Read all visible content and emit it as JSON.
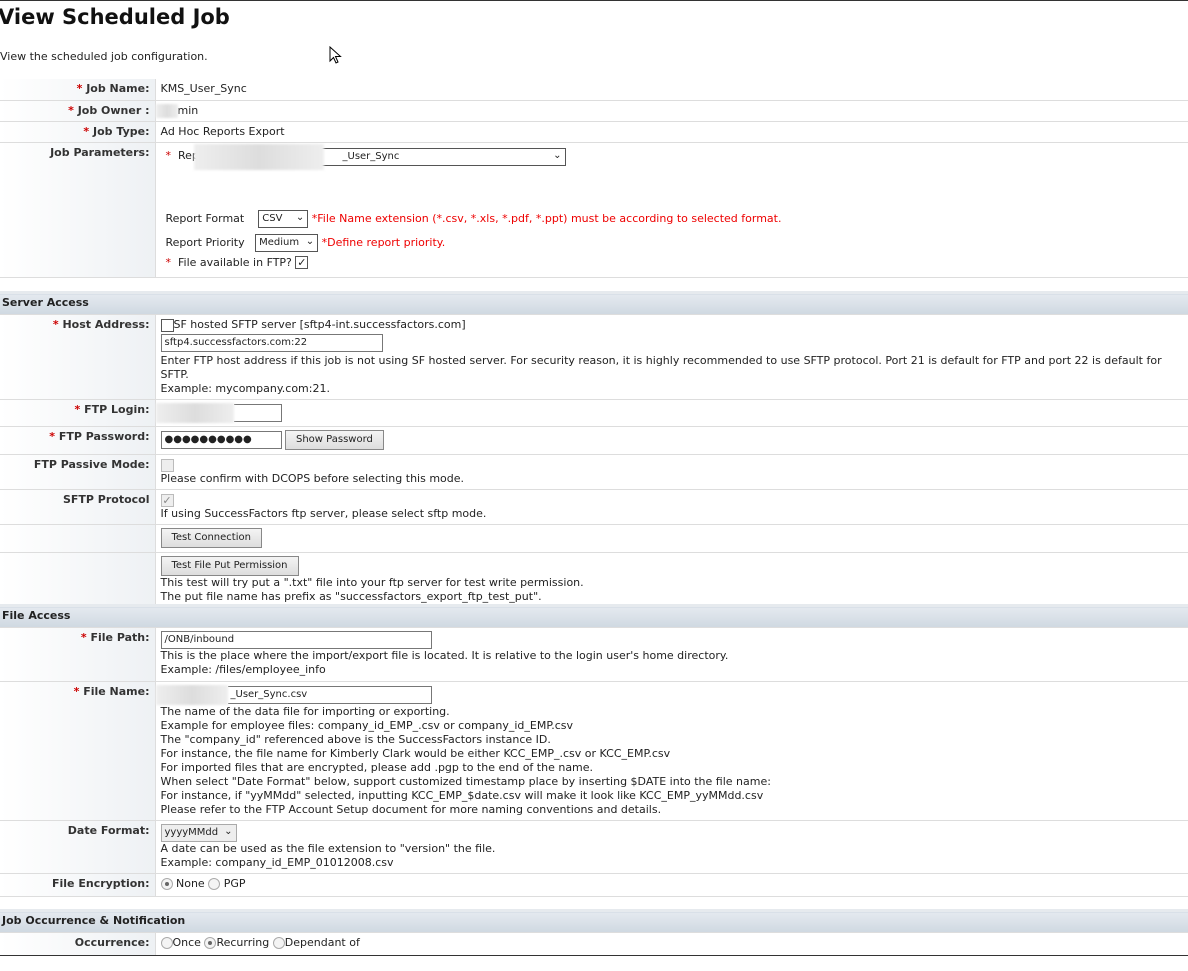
{
  "page": {
    "title": "View Scheduled Job",
    "subtitle": "View the scheduled job configuration."
  },
  "job": {
    "name_label": "Job Name:",
    "name": "KMS_User_Sync",
    "owner_label": "Job Owner :",
    "owner": "min",
    "type_label": "Job Type:",
    "type": "Ad Hoc Reports Export",
    "params_label": "Job Parameters:",
    "report_label": "Repo",
    "report_value": "_User_Sync",
    "format_label": "Report Format",
    "format_value": "CSV",
    "format_note": "*File Name extension (*.csv, *.xls, *.pdf, *.ppt) must be according to selected format.",
    "priority_label": "Report Priority",
    "priority_value": "Medium",
    "priority_note": "*Define report priority.",
    "ftp_label": "File available in FTP?",
    "ftp_checked": true
  },
  "server": {
    "header": "Server Access",
    "host_label": "Host Address:",
    "sf_hosted_label": "SF hosted SFTP server [sftp4-int.successfactors.com]",
    "sf_hosted_checked": false,
    "host_value": "sftp4.successfactors.com:22",
    "host_help": "Enter FTP host address if this job is not using SF hosted server. For security reason, it is highly recommended to use SFTP protocol. Port 21 is default for FTP and port 22 is default for SFTP.",
    "host_example": "Example: mycompany.com:21.",
    "login_label": "FTP Login:",
    "password_label": "FTP Password:",
    "password_value": "●●●●●●●●●●",
    "show_password": "Show Password",
    "passive_label": "FTP Passive Mode:",
    "passive_help": "Please confirm with DCOPS before selecting this mode.",
    "passive_checked": false,
    "sftp_label": "SFTP Protocol",
    "sftp_help": "If using SuccessFactors ftp server, please select sftp mode.",
    "sftp_checked": true,
    "test_connection": "Test Connection",
    "test_put": "Test File Put Permission",
    "test_put_help1": "This test will try put a \".txt\" file into your ftp server for test write permission.",
    "test_put_help2": "The put file name has prefix as \"successfactors_export_ftp_test_put\"."
  },
  "file": {
    "header": "File Access",
    "path_label": "File Path:",
    "path_value": "/ONB/inbound",
    "path_help": "This is the place where the import/export file is located. It is relative to the login user's home directory.",
    "path_example": "Example: /files/employee_info",
    "name_label": "File Name:",
    "name_value": "_User_Sync.csv",
    "name_help": [
      "The name of the data file for importing or exporting.",
      "Example for employee files: company_id_EMP_.csv or company_id_EMP.csv",
      "The \"company_id\" referenced above is the SuccessFactors instance ID.",
      "For instance, the file name for Kimberly Clark would be either KCC_EMP_.csv or KCC_EMP.csv",
      "For imported files that are encrypted, please add .pgp to the end of the name.",
      "When select \"Date Format\" below, support customized timestamp place by inserting $DATE into the file name:",
      "For instance, if \"yyMMdd\" selected, inputting KCC_EMP_$date.csv will make it look like KCC_EMP_yyMMdd.csv",
      "Please refer to the FTP Account Setup document for more naming conventions and details."
    ],
    "date_label": "Date Format:",
    "date_value": "yyyyMMdd",
    "date_help": "A date can be used as the file extension to \"version\" the file.",
    "date_example": "Example: company_id_EMP_01012008.csv",
    "enc_label": "File Encryption:",
    "enc_none": "None",
    "enc_pgp": "PGP",
    "enc_selected": "None"
  },
  "occurrence": {
    "header": "Job Occurrence & Notification",
    "label": "Occurrence:",
    "once": "Once",
    "recurring": "Recurring",
    "dependant": "Dependant of",
    "selected": "Recurring"
  },
  "req_mark": "*"
}
